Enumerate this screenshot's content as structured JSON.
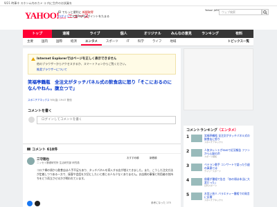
{
  "notice": "9/21 時事ネ スホンム内のカメ コ 内に生件のお試乗を",
  "header": {
    "logo_main": "YAHOO!",
    "logo_sub": "JAPAN",
    "logo_news": "ニュース",
    "line1": "ID でもっと便利に",
    "line1_red": "新規取得",
    "line2_login": "ログイン",
    "line2": "で大量PayPayポイントをたまる",
    "right": "Yahoo! JAPAN",
    "search_placeholder": "ウェブ検索",
    "search_icon": "search-icon"
  },
  "nav_primary": [
    "トップ",
    "速報",
    "ライブ",
    "個人",
    "オリジナル",
    "みんなの意見",
    "ランキング",
    "有料"
  ],
  "nav_primary_active": 0,
  "nav_secondary": [
    "主要",
    "国内",
    "国際",
    "経済",
    "エンタメ",
    "スポーツ",
    "IT",
    "科学",
    "ライフ",
    "地域"
  ],
  "nav_secondary_active": 4,
  "nav_topics": "トピックス一覧",
  "ie_banner": {
    "title": "Internet Explorerではページを正しく表示できません",
    "desc": "他のブラウザーからアクセスするか、スマートフォンからご覧ください。",
    "link": "推奨ブラウザーについて",
    "icon": "warning-icon"
  },
  "article": {
    "headline": "笑福亭鶴瓶　全注文がタッチパネル式の飲食店に怒り「そこにおるのになんやねん。腹立つで」",
    "source": "スポニチアネックス",
    "time": "9/5(金) 19:47 配信"
  },
  "comment_form": {
    "heading": "コメントを書く",
    "placeholder": "ログインしてコメントを書く"
  },
  "comments": {
    "label": "コメント",
    "count": "618件",
    "expert": {
      "name": "三守翔也",
      "role": "ニッセイ基礎研究所 生活研究部 研究員",
      "filter1": "おすすめ順",
      "filter2": "新着順",
      "body": "コロナ禍の頃から飲食店は人手不足もあり、タッチパネルを導入する店が増えてきました。また、こうした注文方法が定着しつつある一方で、接客や会話を大切にしたいと感じる人も少なくありません。お店側の事情と利用者の気持ちをどう両立させるかが問われています。"
    },
    "helpful_label": "参考になった",
    "helpful_count": "175"
  },
  "ranking": {
    "title": "コメントランキング",
    "genre": "（エンタメ）",
    "items": [
      {
        "num": "1",
        "text": "笑福亭鶴瓶 全注文がタッチパネル式の飲食店に怒り",
        "src": "スポニチアネックス"
      },
      {
        "num": "2",
        "text": "人気タレントがSNSで近況報告 ファンから心配の声",
        "src": "スポーツ報知"
      },
      {
        "num": "3",
        "text": "ベテラン歌手 コンサートで語った引退の真意とは",
        "src": "デイリースポーツ"
      },
      {
        "num": "4",
        "text": "俳優が番組で告白 「あの頃は本当に大変だった」",
        "src": "日刊スポーツ"
      },
      {
        "num": "5",
        "text": "お笑い芸人 バラエティー番組での発言に反響",
        "src": "スポニチアネックス"
      }
    ]
  },
  "colors": {
    "accent": "#ff0033",
    "nav_bg": "#363636",
    "link": "#0033cc"
  }
}
